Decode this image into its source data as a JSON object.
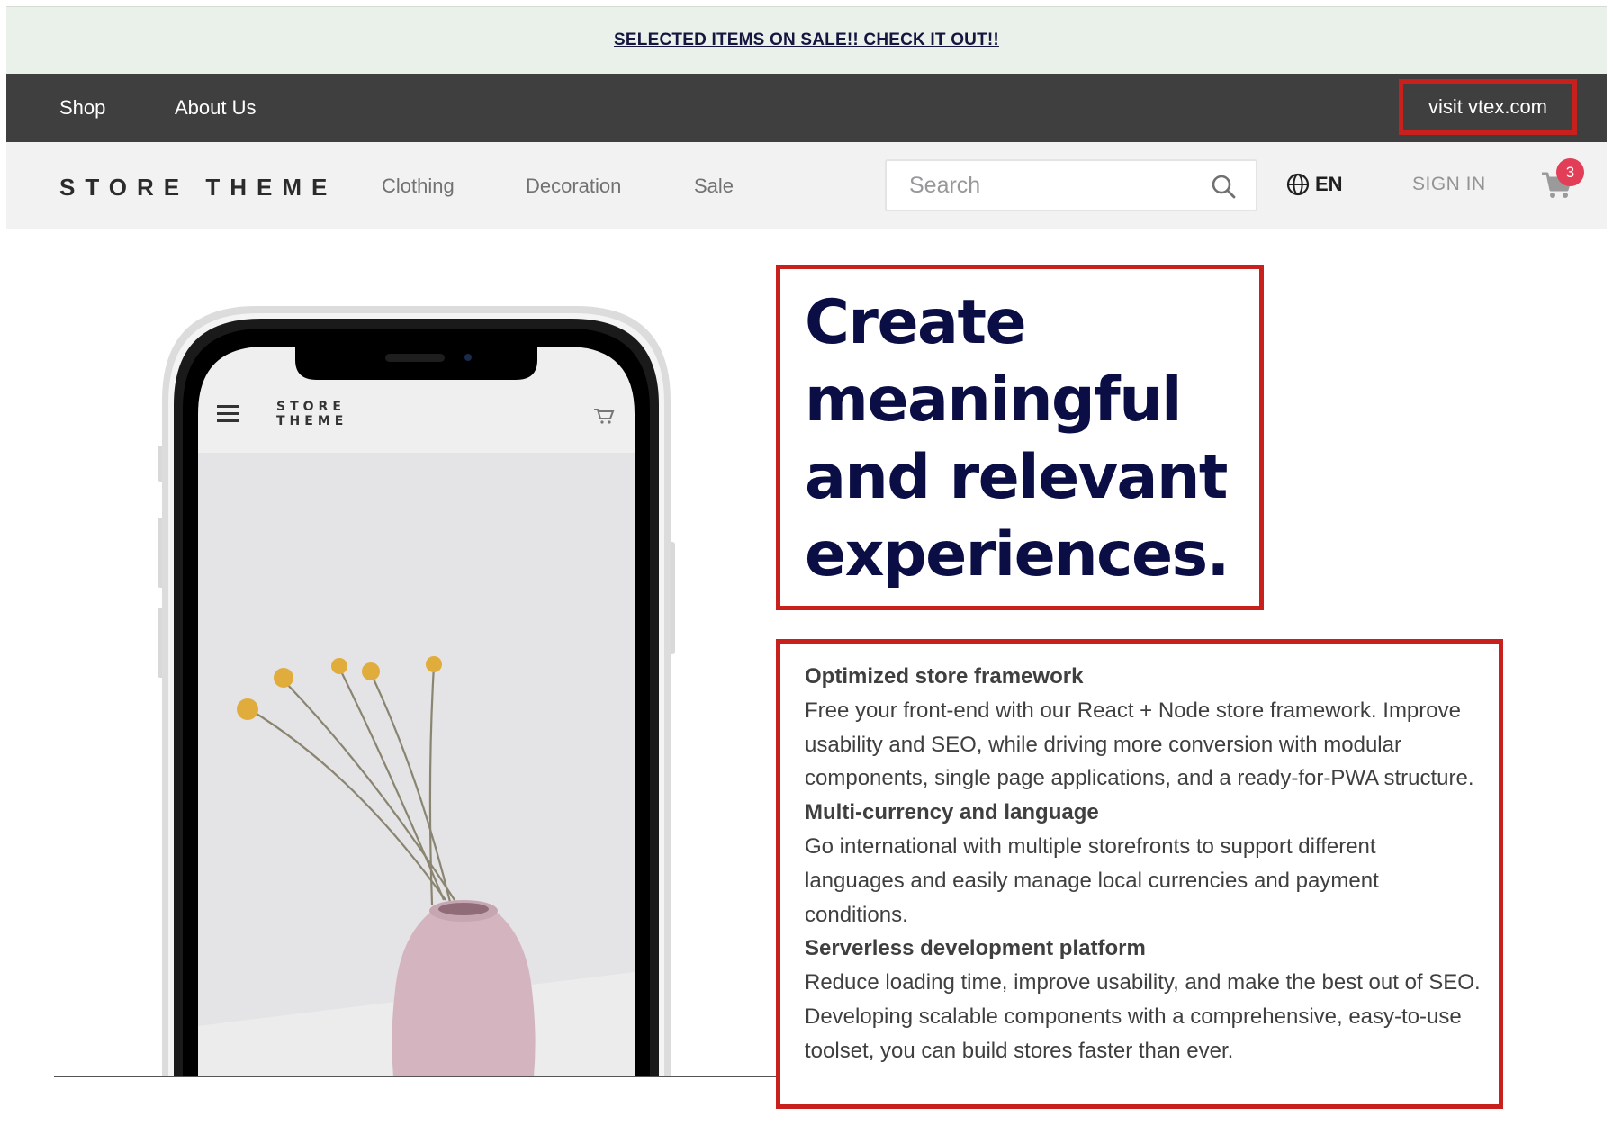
{
  "promo": {
    "text": "SELECTED ITEMS ON SALE!! CHECK IT OUT!!"
  },
  "top_nav": {
    "items": [
      {
        "label": "Shop"
      },
      {
        "label": "About Us"
      }
    ],
    "external_link": "visit vtex.com"
  },
  "header": {
    "logo": "STORE THEME",
    "categories": [
      {
        "label": "Clothing"
      },
      {
        "label": "Decoration"
      },
      {
        "label": "Sale"
      }
    ],
    "search": {
      "placeholder": "Search",
      "value": ""
    },
    "language": "EN",
    "sign_in": "SIGN IN",
    "cart_count": "3"
  },
  "phone_mockup": {
    "logo_line1": "STORE",
    "logo_line2": "THEME"
  },
  "hero": {
    "headline_lines": [
      "Create",
      "meaningful",
      "and relevant",
      "experiences."
    ]
  },
  "features": [
    {
      "title": "Optimized store framework",
      "text": "Free your front-end with our React + Node store framework. Improve usability and SEO, while driving more conversion with modular components, single page applications, and a ready-for-PWA structure."
    },
    {
      "title": "Multi-currency and language",
      "text": "Go international with multiple storefronts to support different languages and easily manage local currencies and payment conditions."
    },
    {
      "title": "Serverless development platform",
      "text": "Reduce loading time, improve usability, and make the best out of SEO. Developing scalable components with a comprehensive, easy-to-use toolset, you can build stores faster than ever."
    }
  ],
  "colors": {
    "promo_bg": "#e9f1ea",
    "nav_bg": "#3f3f3f",
    "header_bg": "#f2f2f2",
    "headline": "#0b0d45",
    "highlight_border": "#c8201c",
    "badge": "#e23e57"
  },
  "icons": [
    "search-icon",
    "globe-icon",
    "cart-icon",
    "menu-icon"
  ]
}
